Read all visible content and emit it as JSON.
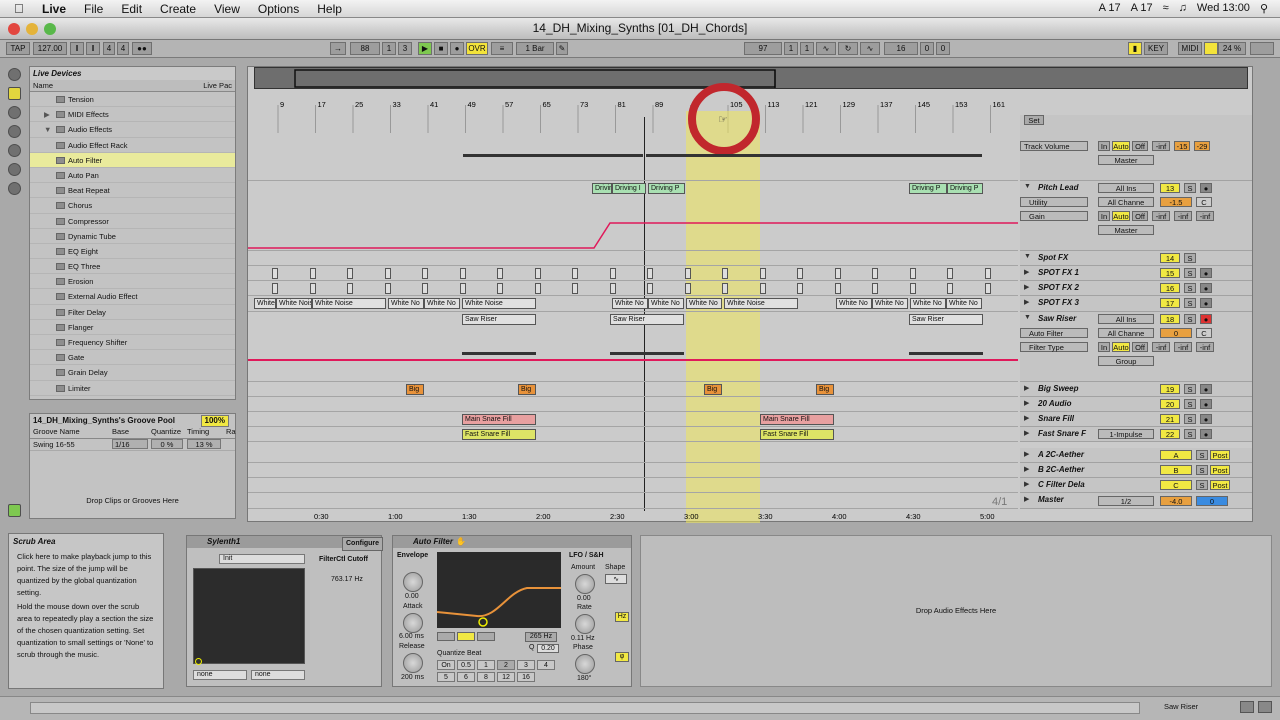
{
  "menubar": {
    "app": "Live",
    "items": [
      "File",
      "Edit",
      "Create",
      "View",
      "Options",
      "Help"
    ],
    "right": [
      "A 17",
      "A 17",
      "Wed 13:00"
    ]
  },
  "window": {
    "title": "14_DH_Mixing_Synths  [01_DH_Chords]"
  },
  "transport": {
    "tap": "TAP",
    "tempo": "127.00",
    "sig_num": "4",
    "sig_den": "4",
    "pos1": "88",
    "pos2": "1",
    "pos3": "3",
    "ovr": "OVR",
    "quant": "1 Bar",
    "loop1": "97",
    "loop2": "1",
    "loop3": "1",
    "len1": "16",
    "len2": "0",
    "len3": "0",
    "key": "KEY",
    "midi": "MIDI",
    "cpu": "24 %"
  },
  "browser": {
    "title": "Live Devices",
    "col_name": "Name",
    "col_place": "Live Pac",
    "items": [
      "Tension",
      "MIDI Effects",
      "Audio Effects",
      "Audio Effect Rack",
      "Auto Filter",
      "Auto Pan",
      "Beat Repeat",
      "Chorus",
      "Compressor",
      "Dynamic Tube",
      "EQ Eight",
      "EQ Three",
      "Erosion",
      "External Audio Effect",
      "Filter Delay",
      "Flanger",
      "Frequency Shifter",
      "Gate",
      "Grain Delay",
      "Limiter"
    ]
  },
  "groove": {
    "title": "14_DH_Mixing_Synths's Groove Pool",
    "pct": "100%",
    "cols": [
      "Groove Name",
      "Base",
      "Quantize",
      "Timing",
      "Ra"
    ],
    "row": {
      "name": "Swing 16-55",
      "base": "1/16",
      "quantize": "0 %",
      "timing": "13 %"
    },
    "drop": "Drop Clips or Grooves Here"
  },
  "ruler": {
    "bars": [
      "9",
      "17",
      "25",
      "33",
      "41",
      "49",
      "57",
      "65",
      "73",
      "81",
      "89",
      "97",
      "105",
      "113",
      "121",
      "129",
      "137",
      "145",
      "153",
      "161"
    ],
    "times": [
      "0:30",
      "1:00",
      "1:30",
      "2:00",
      "2:30",
      "3:00",
      "3:30",
      "4:00",
      "4:30",
      "5:00"
    ],
    "pos": "4/1"
  },
  "clips": {
    "driving": "Driving P",
    "driving2": "Driving I",
    "whitenoise": "White Noise",
    "wn2": "White No",
    "sawriser": "Saw Riser",
    "big": "Big",
    "mainsnare": "Main Snare Fill",
    "fastsnare": "Fast Snare Fill"
  },
  "tracks": {
    "set": "Set",
    "track_volume": "Track Volume",
    "master_label": "Master",
    "in": "In",
    "auto": "Auto",
    "off": "Off",
    "inf": "-inf",
    "v15": "-15",
    "v29": "-29",
    "pitch_lead": "Pitch Lead",
    "all_ins": "All Ins",
    "utility": "Utility",
    "all_chan": "All Channe",
    "gain": "Gain",
    "n13": "13",
    "m15": "-1.5",
    "c": "C",
    "s": "S",
    "spot_fx": "Spot FX",
    "spot_fx1": "SPOT FX 1",
    "spot_fx2": "SPOT FX 2",
    "spot_fx3": "SPOT FX 3",
    "n14": "14",
    "n15": "15",
    "n16": "16",
    "n17": "17",
    "saw_riser": "Saw Riser",
    "auto_filter": "Auto Filter",
    "filter_type": "Filter Type",
    "n18": "18",
    "zero": "0",
    "group": "Group",
    "big_sweep": "Big Sweep",
    "audio20": "20 Audio",
    "snare_fill": "Snare Fill",
    "fast_snare": "Fast Snare F",
    "impulse": "1-Impulse",
    "n19": "19",
    "n20": "20",
    "n21": "21",
    "n22": "22",
    "a_aether": "A 2C-Aether",
    "b_aether": "B 2C-Aether",
    "c_filter": "C Filter Dela",
    "master": "Master",
    "ra": "A",
    "rb": "B",
    "rc": "C",
    "post": "Post",
    "half": "1/2",
    "mvol": "-4.0",
    "mzero": "0"
  },
  "info": {
    "title": "Scrub Area",
    "p1": "Click here to make playback jump to this point. The size of the jump will be quantized by the global quantization setting.",
    "p2": "Hold the mouse down over the scrub area to repeatedly play a section the size of the chosen quantization setting. Set quantization to small settings or 'None' to scrub through the music."
  },
  "sylenth": {
    "name": "Sylenth1",
    "configure": "Configure",
    "preset": "Init",
    "param": "FilterCtl Cutoff",
    "value": "763.17 Hz",
    "none1": "none",
    "none2": "none"
  },
  "autofilter": {
    "name": "Auto Filter",
    "envelope": "Envelope",
    "amount": "0.00",
    "attack": "Attack",
    "att_v": "6.00 ms",
    "release": "Release",
    "rel_v": "200 ms",
    "freq": "265 Hz",
    "q": "Q",
    "q_v": "0.20",
    "qbeat": "Quantize Beat",
    "qb": [
      "On",
      "0.5",
      "1",
      "2",
      "3",
      "4",
      "5",
      "6",
      "8",
      "12",
      "16"
    ],
    "lfo": "LFO / S&H",
    "lfo_amt": "Amount",
    "lfo_amt_v": "0.00",
    "shape": "Shape",
    "rate": "Rate",
    "rate_v": "0.11 Hz",
    "phase": "Phase",
    "phase_v": "180°",
    "hz": "Hz"
  },
  "dropfx": "Drop Audio Effects Here",
  "statusbar": {
    "track": "Saw Riser"
  },
  "colors": {
    "accent": "#f1e843",
    "clip_green": "#a9e0b2",
    "clip_orange": "#e8923a",
    "clip_red": "#e8a0a0",
    "auto_red": "#e0195a",
    "cue": "#c1272d"
  }
}
